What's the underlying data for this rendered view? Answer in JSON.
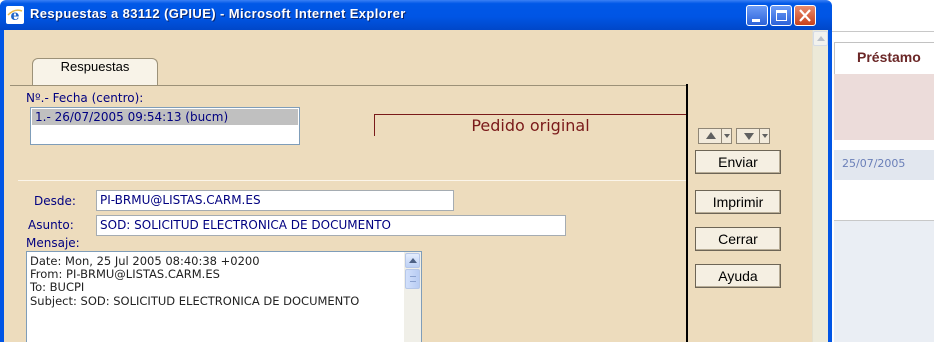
{
  "window": {
    "title": "Respuestas a 83112 (GPIUE) - Microsoft Internet Explorer",
    "icon": "internet-explorer-icon"
  },
  "tabs": [
    {
      "label": "Respuestas",
      "selected": true
    }
  ],
  "fecha": {
    "label": "Nº.- Fecha (centro):",
    "items": [
      "1.- 26/07/2005 09:54:13 (bucm)"
    ],
    "selected_index": 0
  },
  "pedido_original": {
    "label": "Pedido original"
  },
  "form": {
    "desde_label": "Desde:",
    "desde_value": "PI-BRMU@LISTAS.CARM.ES",
    "asunto_label": "Asunto:",
    "asunto_value": "SOD: SOLICITUD ELECTRONICA DE DOCUMENTO",
    "mensaje_label": "Mensaje:",
    "mensaje_lines": [
      "Date: Mon, 25 Jul 2005 08:40:38 +0200",
      "From: PI-BRMU@LISTAS.CARM.ES",
      "To: BUCPI",
      "Subject: SOD: SOLICITUD ELECTRONICA DE DOCUMENTO"
    ]
  },
  "buttons": {
    "enviar": "Enviar",
    "imprimir": "Imprimir",
    "cerrar": "Cerrar",
    "ayuda": "Ayuda",
    "nav_up_icon": "arrow-up-icon",
    "nav_down_icon": "arrow-down-icon"
  },
  "background_page": {
    "header_text": "Préstamo",
    "date_text": "25/07/2005"
  },
  "colors": {
    "titlebar": "#0055e5",
    "panel_bg": "#eddcbd",
    "label_text": "#000080",
    "pedido_text": "#7a1a1a",
    "bg_header_text": "#6b2727"
  }
}
